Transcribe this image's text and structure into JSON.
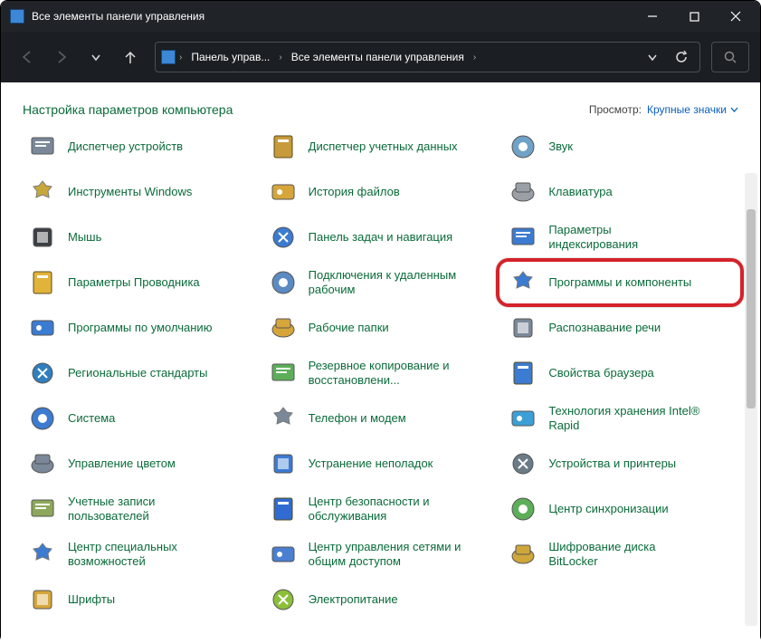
{
  "window": {
    "title": "Все элементы панели управления"
  },
  "breadcrumb": {
    "root": "Панель управ...",
    "current": "Все элементы панели управления"
  },
  "heading": "Настройка параметров компьютера",
  "view": {
    "label": "Просмотр:",
    "value": "Крупные значки"
  },
  "items": [
    {
      "label": "Диспетчер устройств"
    },
    {
      "label": "Диспетчер учетных данных"
    },
    {
      "label": "Звук"
    },
    {
      "label": "Инструменты Windows"
    },
    {
      "label": "История файлов"
    },
    {
      "label": "Клавиатура"
    },
    {
      "label": "Мышь"
    },
    {
      "label": "Панель задач и навигация"
    },
    {
      "label": "Параметры индексирования"
    },
    {
      "label": "Параметры Проводника"
    },
    {
      "label": "Подключения к удаленным рабочим"
    },
    {
      "label": "Программы и компоненты"
    },
    {
      "label": "Программы по умолчанию"
    },
    {
      "label": "Рабочие папки"
    },
    {
      "label": "Распознавание речи"
    },
    {
      "label": "Региональные стандарты"
    },
    {
      "label": "Резервное копирование и восстановлени..."
    },
    {
      "label": "Свойства браузера"
    },
    {
      "label": "Система"
    },
    {
      "label": "Телефон и модем"
    },
    {
      "label": "Технология хранения Intel® Rapid"
    },
    {
      "label": "Управление цветом"
    },
    {
      "label": "Устранение неполадок"
    },
    {
      "label": "Устройства и принтеры"
    },
    {
      "label": "Учетные записи пользователей"
    },
    {
      "label": "Центр безопасности и обслуживания"
    },
    {
      "label": "Центр синхронизации"
    },
    {
      "label": "Центр специальных возможностей"
    },
    {
      "label": "Центр управления сетями и общим доступом"
    },
    {
      "label": "Шифрование диска BitLocker"
    },
    {
      "label": "Шрифты"
    },
    {
      "label": "Электропитание"
    }
  ],
  "icon_colors": [
    "#7a8899",
    "#c79b3a",
    "#6fa2c7",
    "#c8a83b",
    "#d6a63a",
    "#9aa0a6",
    "#3a3f44",
    "#3b7bd1",
    "#3b7bd1",
    "#e2b33a",
    "#5b8bc2",
    "#3b7bd1",
    "#3b7bd1",
    "#d6a63a",
    "#7a8899",
    "#2f7fbf",
    "#5cae58",
    "#3b7bd1",
    "#3b7bd1",
    "#7a8899",
    "#3c9fd6",
    "#7a8899",
    "#3b7bd1",
    "#6b7b87",
    "#8da85a",
    "#2f6bd1",
    "#5cae58",
    "#3b7bd1",
    "#4a7fd1",
    "#cfa63a",
    "#d6a63a",
    "#8bbf3a"
  ],
  "highlight_index": 11
}
